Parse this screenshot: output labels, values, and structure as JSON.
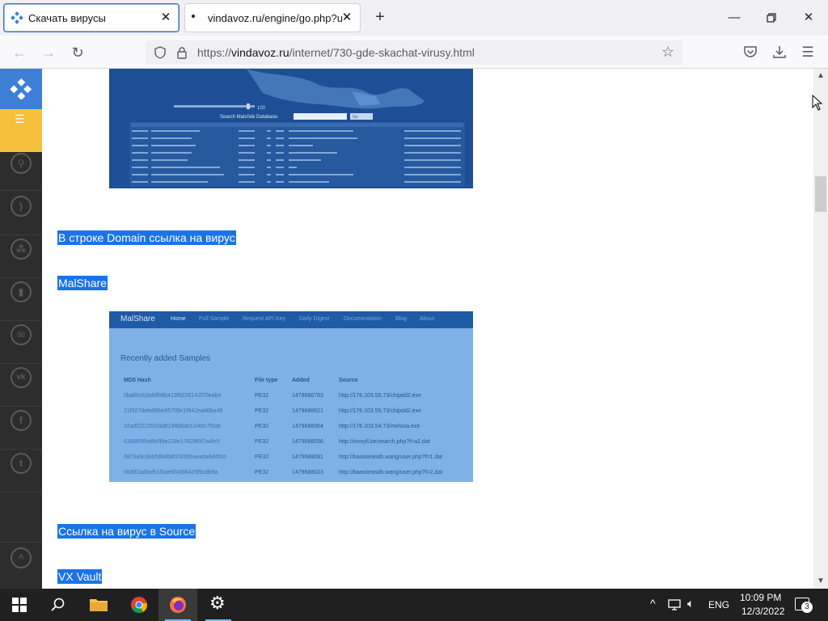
{
  "browser": {
    "tabs": [
      {
        "title": "Скачать вирусы",
        "active": true
      },
      {
        "title": "vindavoz.ru/engine/go.php?url=",
        "active": false
      }
    ],
    "url_prefix": "https://",
    "url_domain": "vindavoz.ru",
    "url_path": "/internet/730-gde-skachat-virusy.html"
  },
  "content": {
    "line1": "В строке Domain ссылка на вирус",
    "heading_malshare": "MalShare",
    "line2": "Ссылка на вирус в Source",
    "heading_vxvault": "VX Vault"
  },
  "malware_image": {
    "search_label": "Search Malc0de Database:",
    "search_button": "Go"
  },
  "malshare_image": {
    "brand": "MalShare",
    "nav": [
      "Home",
      "Pull Sample",
      "Request API Key",
      "Daily Digest",
      "Documentation",
      "Blog",
      "About"
    ],
    "section_title": "Recently added Samples",
    "columns": [
      "MD5 Hash",
      "File type",
      "Added",
      "Source"
    ],
    "rows": [
      [
        "0baf0c81bd4f98b413f9228141f70eab4",
        "PE32",
        "1479686783",
        "http://176.103.55.73/chipdd2.exe"
      ],
      [
        "21f0278ebd8fbe85709c1f542ead6ba46",
        "PE32",
        "1479688621",
        "http://176.103.55.73/chipdd2.exe"
      ],
      [
        "32adf2222f02ad8198b6ab1cf46c7f5a6",
        "PE32",
        "1479688364",
        "http://176.103.54.73/melona.exe"
      ],
      [
        "618565f9a8b0f8e128e17629f0f7a4fe5",
        "PE32",
        "1479688056",
        "http://vinoyll.be/search.php?f=a2.dat"
      ],
      [
        "6873a9c89b5984b8f15f355aeada9d4f2d",
        "PE32",
        "1479688031",
        "http://baasionealb.wang/user.php?f=1.dat"
      ],
      [
        "6fd5f2ad8afb1f0ae6f4386425f9cdb9a",
        "PE32",
        "1479688023",
        "http://baasionealb.wang/user.php?f=2.dat"
      ]
    ]
  },
  "taskbar": {
    "time": "10:09 PM",
    "date": "12/3/2022",
    "lang": "ENG",
    "notifications": "3"
  },
  "colors": {
    "highlight": "#1a73e8",
    "sidebar_bg": "#2d2d2d",
    "sidebar_logo": "#3d7fd6",
    "sidebar_menu": "#f5c13c",
    "taskbar_bg": "#202020"
  }
}
